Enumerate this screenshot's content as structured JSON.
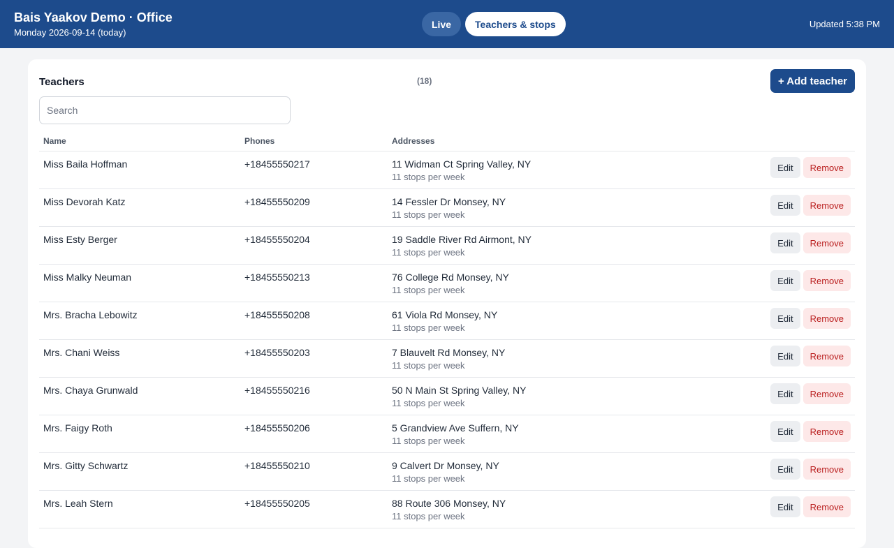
{
  "header": {
    "title": "Bais Yaakov Demo · Office",
    "date": "Monday 2026-09-14 (today)",
    "tabs": [
      "Live",
      "Teachers & stops"
    ],
    "updated": "Updated 5:38 PM"
  },
  "panel": {
    "title": "Teachers",
    "count": "(18)",
    "add_label": "+ Add teacher",
    "search_placeholder": "Search"
  },
  "table": {
    "columns": [
      "Name",
      "Phones",
      "Addresses"
    ],
    "edit_label": "Edit",
    "remove_label": "Remove",
    "rows": [
      {
        "name": "Miss Baila Hoffman",
        "phone": "+18455550217",
        "address": "11 Widman Ct Spring Valley, NY",
        "stops": "11 stops per week"
      },
      {
        "name": "Miss Devorah Katz",
        "phone": "+18455550209",
        "address": "14 Fessler Dr Monsey, NY",
        "stops": "11 stops per week"
      },
      {
        "name": "Miss Esty Berger",
        "phone": "+18455550204",
        "address": "19 Saddle River Rd Airmont, NY",
        "stops": "11 stops per week"
      },
      {
        "name": "Miss Malky Neuman",
        "phone": "+18455550213",
        "address": "76 College Rd Monsey, NY",
        "stops": "11 stops per week"
      },
      {
        "name": "Mrs. Bracha Lebowitz",
        "phone": "+18455550208",
        "address": "61 Viola Rd Monsey, NY",
        "stops": "11 stops per week"
      },
      {
        "name": "Mrs. Chani Weiss",
        "phone": "+18455550203",
        "address": "7 Blauvelt Rd Monsey, NY",
        "stops": "11 stops per week"
      },
      {
        "name": "Mrs. Chaya Grunwald",
        "phone": "+18455550216",
        "address": "50 N Main St Spring Valley, NY",
        "stops": "11 stops per week"
      },
      {
        "name": "Mrs. Faigy Roth",
        "phone": "+18455550206",
        "address": "5 Grandview Ave Suffern, NY",
        "stops": "11 stops per week"
      },
      {
        "name": "Mrs. Gitty Schwartz",
        "phone": "+18455550210",
        "address": "9 Calvert Dr Monsey, NY",
        "stops": "11 stops per week"
      },
      {
        "name": "Mrs. Leah Stern",
        "phone": "+18455550205",
        "address": "88 Route 306 Monsey, NY",
        "stops": "11 stops per week"
      }
    ]
  }
}
